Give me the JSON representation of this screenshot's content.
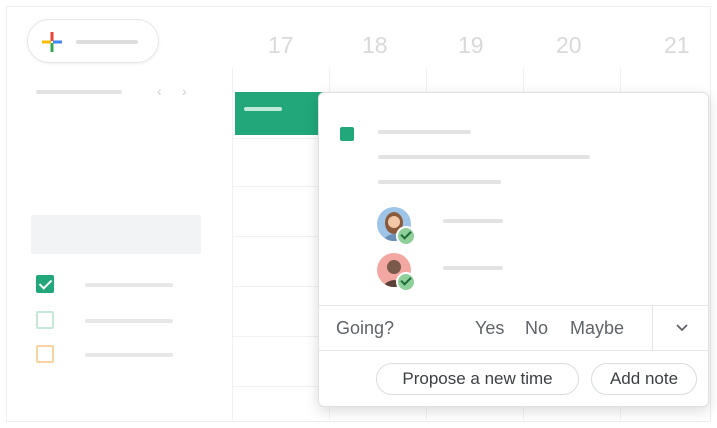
{
  "week": {
    "days": [
      "17",
      "18",
      "19",
      "20",
      "21"
    ]
  },
  "colors": {
    "accent": "#21a77a",
    "secondary_calendar": "#fbd39e",
    "grid": "#f1f1f1"
  },
  "sidebar": {
    "create_icon": "multicolor-plus-icon",
    "nav": {
      "prev_icon": "chevron-left-icon",
      "next_icon": "chevron-right-icon",
      "prev": "‹",
      "next": "›"
    },
    "calendars": [
      {
        "state": "checked"
      },
      {
        "state": "unchecked-green"
      },
      {
        "state": "unchecked-orange"
      }
    ]
  },
  "popup": {
    "rsvp": {
      "label": "Going?",
      "yes": "Yes",
      "no": "No",
      "maybe": "Maybe",
      "more_icon": "chevron-down-icon"
    },
    "actions": {
      "propose": "Propose a new time",
      "add_note": "Add note"
    },
    "attendees": [
      {
        "icon": "avatar-woman-icon",
        "status": "accepted"
      },
      {
        "icon": "avatar-man-icon",
        "status": "accepted"
      }
    ]
  }
}
